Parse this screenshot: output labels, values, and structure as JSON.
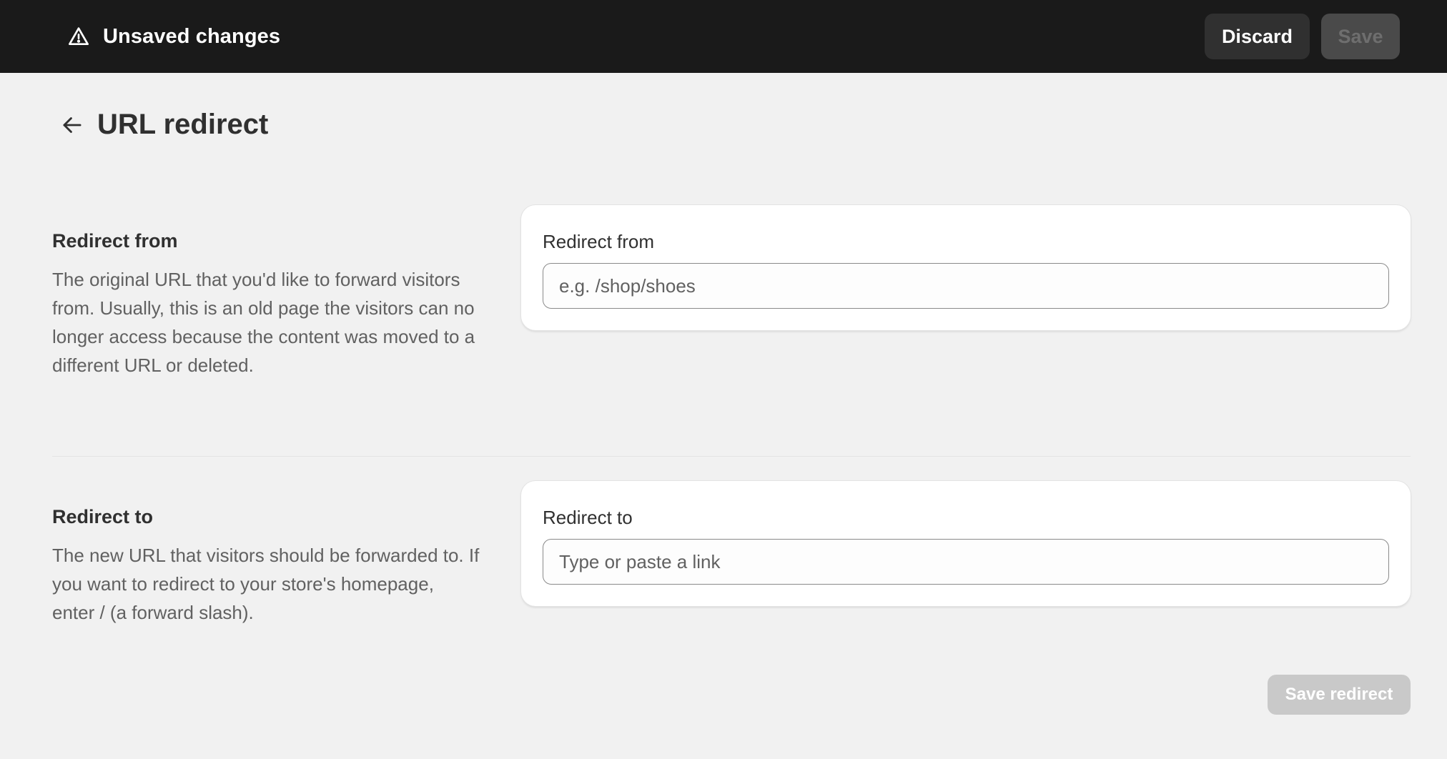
{
  "topbar": {
    "title": "Unsaved changes",
    "icon": "warning-triangle-icon",
    "discard_label": "Discard",
    "save_label": "Save"
  },
  "header": {
    "back_icon": "arrow-left-icon",
    "title": "URL redirect"
  },
  "sections": [
    {
      "heading": "Redirect from",
      "description": "The original URL that you'd like to forward visitors from. Usually, this is an old page the visitors can no longer access because the content was moved to a different URL or deleted.",
      "field_label": "Redirect from",
      "field_value": "",
      "field_placeholder": "e.g. /shop/shoes"
    },
    {
      "heading": "Redirect to",
      "description": "The new URL that visitors should be forwarded to. If you want to redirect to your store's homepage, enter / (a forward slash).",
      "field_label": "Redirect to",
      "field_value": "",
      "field_placeholder": "Type or paste a link"
    }
  ],
  "footer": {
    "save_redirect_label": "Save redirect"
  },
  "colors": {
    "topbar_bg": "#1a1a1a",
    "page_bg": "#f1f1f1",
    "card_bg": "#ffffff",
    "disabled_button": "#c9c9c9"
  }
}
